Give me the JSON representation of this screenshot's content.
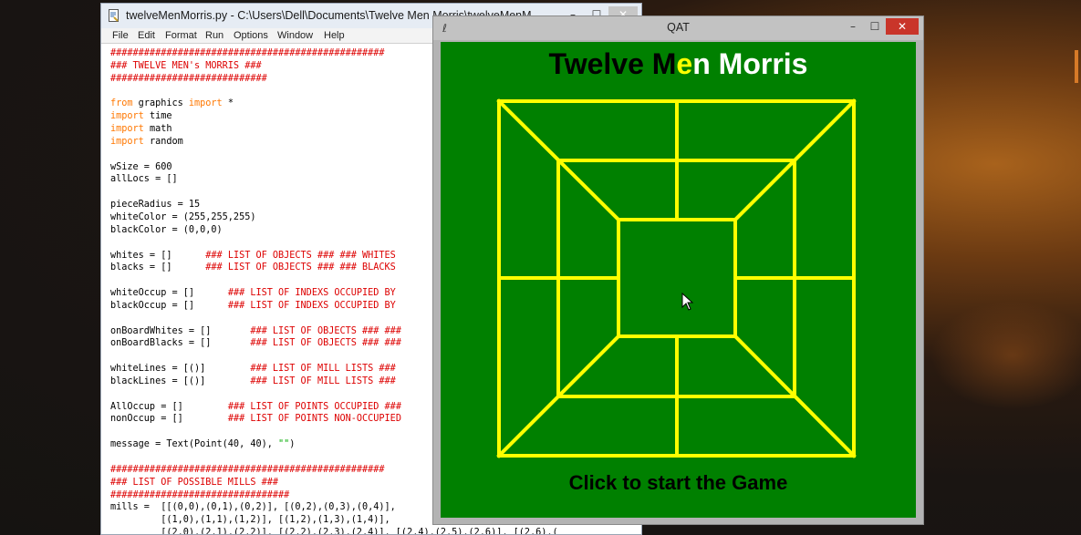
{
  "idle": {
    "title": "twelveMenMorris.py - C:\\Users\\Dell\\Documents\\Twelve Men Morris\\twelveMenM...",
    "menu": [
      "File",
      "Edit",
      "Format",
      "Run",
      "Options",
      "Window",
      "Help"
    ],
    "controls": {
      "minimize": "–",
      "maximize": "☐",
      "close": "✕"
    },
    "code_lines": [
      [
        {
          "t": "#################################################",
          "c": "cm"
        }
      ],
      [
        {
          "t": "### TWELVE MEN's MORRIS ###",
          "c": "cm"
        }
      ],
      [
        {
          "t": "############################",
          "c": "cm"
        }
      ],
      [
        {
          "t": "",
          "c": ""
        }
      ],
      [
        {
          "t": "from",
          "c": "kw"
        },
        {
          "t": " graphics ",
          "c": ""
        },
        {
          "t": "import",
          "c": "kw"
        },
        {
          "t": " *",
          "c": ""
        }
      ],
      [
        {
          "t": "import",
          "c": "kw"
        },
        {
          "t": " time",
          "c": ""
        }
      ],
      [
        {
          "t": "import",
          "c": "kw"
        },
        {
          "t": " math",
          "c": ""
        }
      ],
      [
        {
          "t": "import",
          "c": "kw"
        },
        {
          "t": " random",
          "c": ""
        }
      ],
      [
        {
          "t": "",
          "c": ""
        }
      ],
      [
        {
          "t": "wSize = 600",
          "c": ""
        }
      ],
      [
        {
          "t": "allLocs = []",
          "c": ""
        }
      ],
      [
        {
          "t": "",
          "c": ""
        }
      ],
      [
        {
          "t": "pieceRadius = 15",
          "c": ""
        }
      ],
      [
        {
          "t": "whiteColor = (255,255,255)",
          "c": ""
        }
      ],
      [
        {
          "t": "blackColor = (0,0,0)",
          "c": ""
        }
      ],
      [
        {
          "t": "",
          "c": ""
        }
      ],
      [
        {
          "t": "whites = []      ",
          "c": ""
        },
        {
          "t": "### LIST OF OBJECTS ### ### WHITES",
          "c": "cm"
        }
      ],
      [
        {
          "t": "blacks = []      ",
          "c": ""
        },
        {
          "t": "### LIST OF OBJECTS ### ### BLACKS",
          "c": "cm"
        }
      ],
      [
        {
          "t": "",
          "c": ""
        }
      ],
      [
        {
          "t": "whiteOccup = []      ",
          "c": ""
        },
        {
          "t": "### LIST OF INDEXS OCCUPIED BY",
          "c": "cm"
        }
      ],
      [
        {
          "t": "blackOccup = []      ",
          "c": ""
        },
        {
          "t": "### LIST OF INDEXS OCCUPIED BY",
          "c": "cm"
        }
      ],
      [
        {
          "t": "",
          "c": ""
        }
      ],
      [
        {
          "t": "onBoardWhites = []       ",
          "c": ""
        },
        {
          "t": "### LIST OF OBJECTS ### ###",
          "c": "cm"
        }
      ],
      [
        {
          "t": "onBoardBlacks = []       ",
          "c": ""
        },
        {
          "t": "### LIST OF OBJECTS ### ###",
          "c": "cm"
        }
      ],
      [
        {
          "t": "",
          "c": ""
        }
      ],
      [
        {
          "t": "whiteLines = [()]        ",
          "c": ""
        },
        {
          "t": "### LIST OF MILL LISTS ###",
          "c": "cm"
        }
      ],
      [
        {
          "t": "blackLines = [()]        ",
          "c": ""
        },
        {
          "t": "### LIST OF MILL LISTS ###",
          "c": "cm"
        }
      ],
      [
        {
          "t": "",
          "c": ""
        }
      ],
      [
        {
          "t": "AllOccup = []        ",
          "c": ""
        },
        {
          "t": "### LIST OF POINTS OCCUPIED ###",
          "c": "cm"
        }
      ],
      [
        {
          "t": "nonOccup = []        ",
          "c": ""
        },
        {
          "t": "### LIST OF POINTS NON-OCCUPIED",
          "c": "cm"
        }
      ],
      [
        {
          "t": "",
          "c": ""
        }
      ],
      [
        {
          "t": "message = Text(Point(40, 40), ",
          "c": ""
        },
        {
          "t": "\"\"",
          "c": "st"
        },
        {
          "t": ")",
          "c": ""
        }
      ],
      [
        {
          "t": "",
          "c": ""
        }
      ],
      [
        {
          "t": "#################################################",
          "c": "cm"
        }
      ],
      [
        {
          "t": "### LIST OF POSSIBLE MILLS ###",
          "c": "cm"
        }
      ],
      [
        {
          "t": "################################",
          "c": "cm"
        }
      ],
      [
        {
          "t": "mills =  [[(0,0),(0,1),(0,2)], [(0,2),(0,3),(0,4)],",
          "c": ""
        }
      ],
      [
        {
          "t": "         [(1,0),(1,1),(1,2)], [(1,2),(1,3),(1,4)],",
          "c": ""
        }
      ],
      [
        {
          "t": "         [(2,0),(2,1),(2,2)], [(2,2),(2,3),(2,4)], [(2,4),(2,5),(2,6)], [(2,6),(",
          "c": ""
        }
      ]
    ]
  },
  "qat": {
    "title": "QAT",
    "controls": {
      "minimize": "–",
      "maximize": "☐",
      "close": "✕"
    },
    "game_title": {
      "part1": "Twelve M",
      "part2": "e",
      "part3": "n Morris"
    },
    "status": "Click to start the Game",
    "colors": {
      "canvas": "#008000",
      "lines": "#ffff00"
    }
  }
}
